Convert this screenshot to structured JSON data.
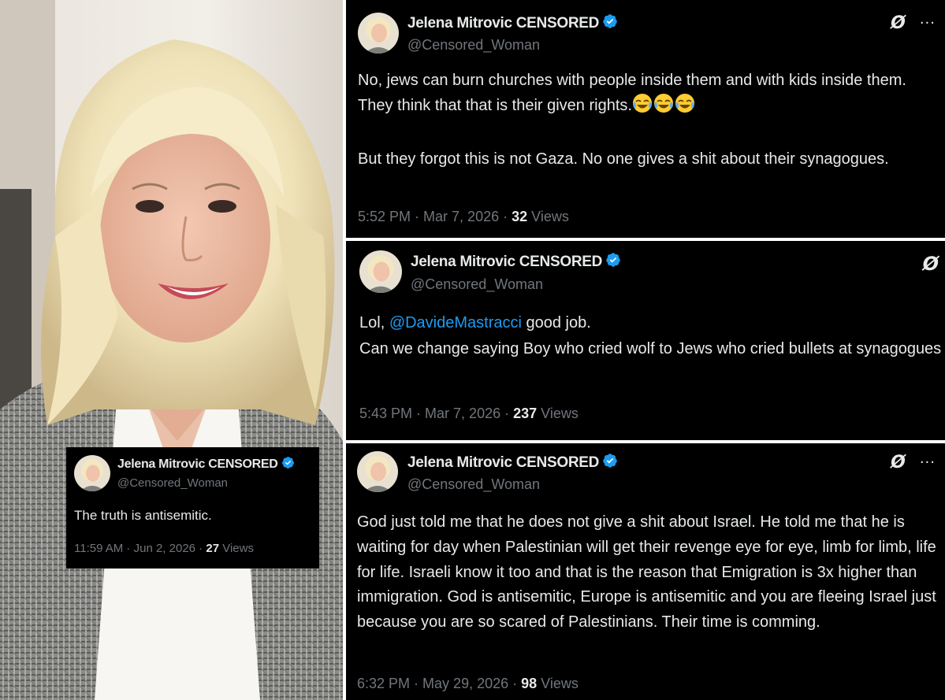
{
  "colors": {
    "tweet_background": "#000000",
    "text_primary": "#e7e9ea",
    "text_secondary": "#71767b",
    "mention_blue": "#1d9bf0",
    "verified_badge": "#1d9bf0"
  },
  "icons": {
    "verified": "verified-badge-icon",
    "grok": "grok-icon",
    "more": "more-options-icon",
    "emoji": "face-with-tears-of-joy-icon"
  },
  "tweets": [
    {
      "author_name": "Jelena Mitrovic CENSORED",
      "author_handle": "@Censored_Woman",
      "paragraph1": "No, jews can burn churches with people inside them and with kids inside them. They think that that is their given rights.",
      "emoji_count": 3,
      "paragraph2": "But they forgot this is not Gaza. No one gives a shit about their synagogues.",
      "time": "5:52 PM",
      "date": "Mar 7, 2026",
      "views_count": "32",
      "views_label": "Views",
      "grok_icon": "Ø",
      "more_icon": "···"
    },
    {
      "author_name": "Jelena Mitrovic CENSORED",
      "author_handle": "@Censored_Woman",
      "text_prefix": "Lol, ",
      "mention": "@DavideMastracci",
      "text_suffix": " good job.\nCan we change saying Boy who cried wolf to Jews who cried bullets at synagogues",
      "time": "5:43 PM",
      "date": "Mar 7, 2026",
      "views_count": "237",
      "views_label": "Views",
      "grok_icon": "Ø"
    },
    {
      "author_name": "Jelena Mitrovic CENSORED",
      "author_handle": "@Censored_Woman",
      "text": "God just told me that he does not give a shit about Israel. He told me that he is waiting for day when Palestinian will get their revenge eye for eye, limb for limb, life for life. Israeli know it too and that is the reason that Emigration is 3x higher than immigration. God is antisemitic, Europe is antisemitic and you are fleeing Israel just because you are so scared of Palestinians. Their time is comming.",
      "time": "6:32 PM",
      "date": "May 29, 2026",
      "views_count": "98",
      "views_label": "Views",
      "grok_icon": "Ø",
      "more_icon": "···"
    },
    {
      "author_name": "Jelena Mitrovic CENSORED",
      "author_handle": "@Censored_Woman",
      "text": "The truth is antisemitic.",
      "time": "11:59 AM",
      "date": "Jun 2, 2026",
      "views_count": "27",
      "views_label": "Views"
    }
  ]
}
